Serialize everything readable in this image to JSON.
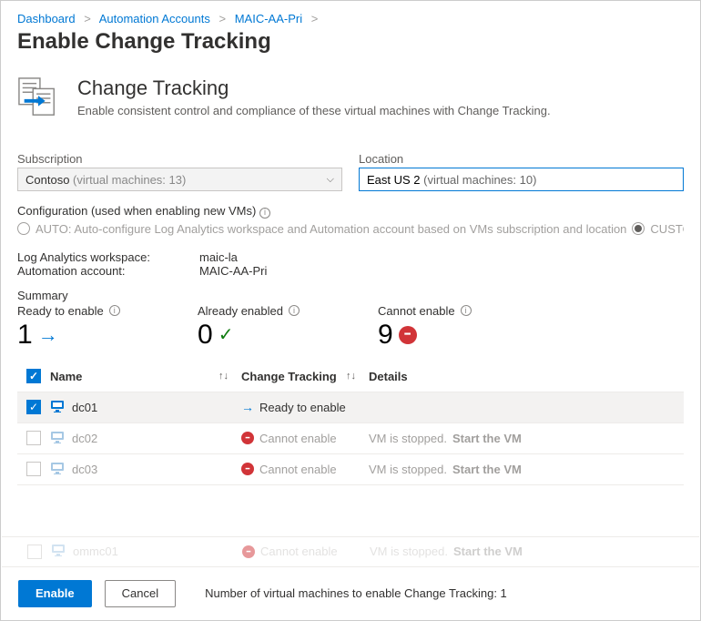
{
  "breadcrumb": [
    "Dashboard",
    "Automation Accounts",
    "MAIC-AA-Pri"
  ],
  "page_title": "Enable Change Tracking",
  "hero": {
    "title": "Change Tracking",
    "subtitle": "Enable consistent control and compliance of these virtual machines with Change Tracking."
  },
  "subscription": {
    "label": "Subscription",
    "name": "Contoso",
    "detail": "(virtual machines: 13)"
  },
  "location": {
    "label": "Location",
    "name": "East US 2",
    "detail": "(virtual machines: 10)"
  },
  "config": {
    "label": "Configuration (used when enabling new VMs)",
    "auto_label": "AUTO: Auto-configure Log Analytics workspace and Automation account based on VMs subscription and location",
    "custom_label": "CUSTOM:"
  },
  "workspace": {
    "label": "Log Analytics workspace:",
    "value": "maic-la"
  },
  "account": {
    "label": "Automation account:",
    "value": "MAIC-AA-Pri"
  },
  "summary": {
    "title": "Summary",
    "ready": {
      "label": "Ready to enable",
      "value": "1"
    },
    "already": {
      "label": "Already enabled",
      "value": "0"
    },
    "cannot": {
      "label": "Cannot enable",
      "value": "9"
    }
  },
  "table": {
    "headers": {
      "name": "Name",
      "ct": "Change Tracking",
      "details": "Details"
    },
    "rows": [
      {
        "name": "dc01",
        "status_kind": "ready",
        "status_text": "Ready to enable",
        "detail": "",
        "action": "",
        "checked": true,
        "enabled": true
      },
      {
        "name": "dc02",
        "status_kind": "cannot",
        "status_text": "Cannot enable",
        "detail": "VM is stopped.",
        "action": "Start the VM",
        "checked": false,
        "enabled": false
      },
      {
        "name": "dc03",
        "status_kind": "cannot",
        "status_text": "Cannot enable",
        "detail": "VM is stopped.",
        "action": "Start the VM",
        "checked": false,
        "enabled": false
      },
      {
        "name": "ommc01",
        "status_kind": "cannot",
        "status_text": "Cannot enable",
        "detail": "VM is stopped.",
        "action": "Start the VM",
        "checked": false,
        "enabled": false
      }
    ]
  },
  "footer": {
    "enable": "Enable",
    "cancel": "Cancel",
    "status": "Number of virtual machines to enable Change Tracking: 1"
  }
}
